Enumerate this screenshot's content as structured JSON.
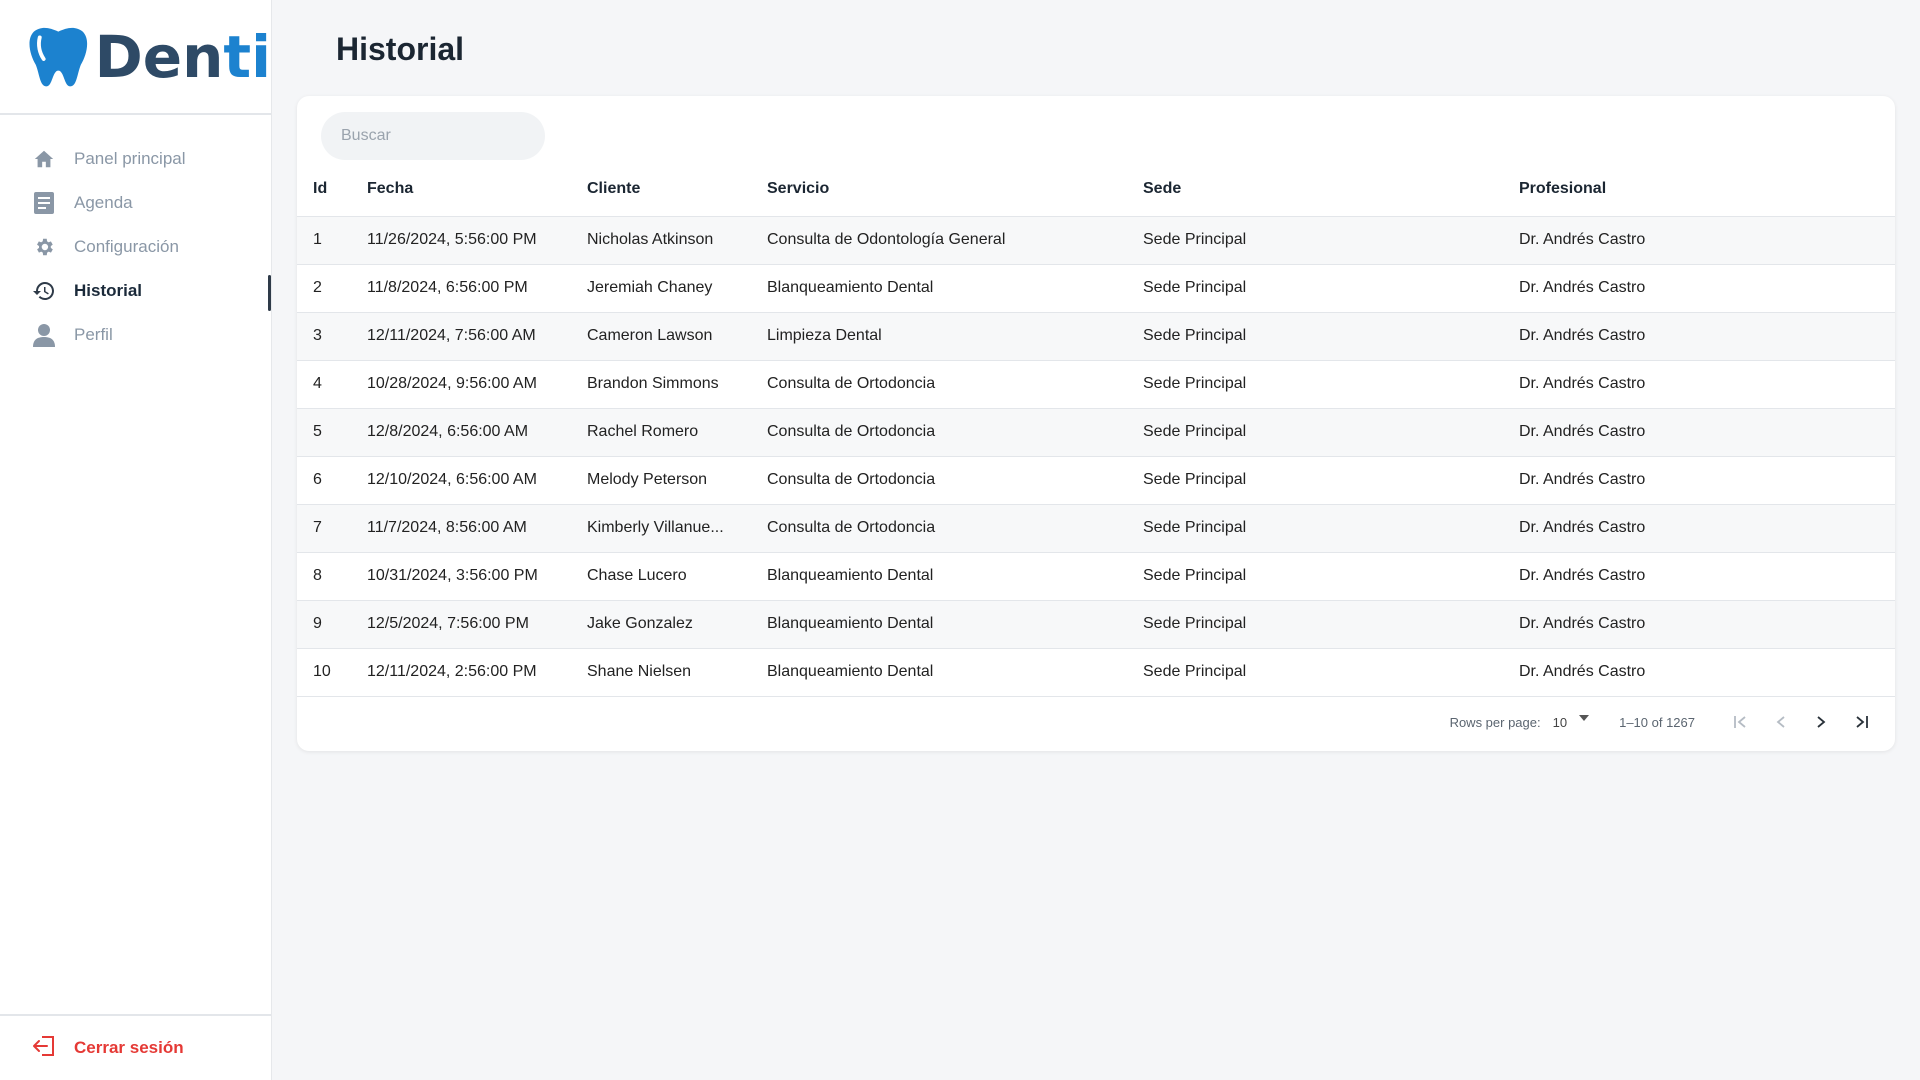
{
  "brand": {
    "part1": "Den",
    "part2": "ti"
  },
  "nav": [
    {
      "label": "Panel principal",
      "icon": "home-icon"
    },
    {
      "label": "Agenda",
      "icon": "book-icon"
    },
    {
      "label": "Configuración",
      "icon": "gear-icon"
    },
    {
      "label": "Historial",
      "icon": "history-icon",
      "active": true
    },
    {
      "label": "Perfil",
      "icon": "user-icon"
    }
  ],
  "logout": {
    "label": "Cerrar sesión",
    "icon": "logout-icon"
  },
  "page": {
    "title": "Historial"
  },
  "search": {
    "placeholder": "Buscar"
  },
  "table": {
    "headers": [
      "Id",
      "Fecha",
      "Cliente",
      "Servicio",
      "Sede",
      "Profesional"
    ],
    "rows": [
      [
        "1",
        "11/26/2024, 5:56:00 PM",
        "Nicholas Atkinson",
        "Consulta de Odontología General",
        "Sede Principal",
        "Dr. Andrés Castro"
      ],
      [
        "2",
        "11/8/2024, 6:56:00 PM",
        "Jeremiah Chaney",
        "Blanqueamiento Dental",
        "Sede Principal",
        "Dr. Andrés Castro"
      ],
      [
        "3",
        "12/11/2024, 7:56:00 AM",
        "Cameron Lawson",
        "Limpieza Dental",
        "Sede Principal",
        "Dr. Andrés Castro"
      ],
      [
        "4",
        "10/28/2024, 9:56:00 AM",
        "Brandon Simmons",
        "Consulta de Ortodoncia",
        "Sede Principal",
        "Dr. Andrés Castro"
      ],
      [
        "5",
        "12/8/2024, 6:56:00 AM",
        "Rachel Romero",
        "Consulta de Ortodoncia",
        "Sede Principal",
        "Dr. Andrés Castro"
      ],
      [
        "6",
        "12/10/2024, 6:56:00 AM",
        "Melody Peterson",
        "Consulta de Ortodoncia",
        "Sede Principal",
        "Dr. Andrés Castro"
      ],
      [
        "7",
        "11/7/2024, 8:56:00 AM",
        "Kimberly Villanue...",
        "Consulta de Ortodoncia",
        "Sede Principal",
        "Dr. Andrés Castro"
      ],
      [
        "8",
        "10/31/2024, 3:56:00 PM",
        "Chase Lucero",
        "Blanqueamiento Dental",
        "Sede Principal",
        "Dr. Andrés Castro"
      ],
      [
        "9",
        "12/5/2024, 7:56:00 PM",
        "Jake Gonzalez",
        "Blanqueamiento Dental",
        "Sede Principal",
        "Dr. Andrés Castro"
      ],
      [
        "10",
        "12/11/2024, 2:56:00 PM",
        "Shane Nielsen",
        "Blanqueamiento Dental",
        "Sede Principal",
        "Dr. Andrés Castro"
      ]
    ]
  },
  "pagination": {
    "rows_label": "Rows per page:",
    "rows_value": "10",
    "range": "1–10 of 1267"
  },
  "colors": {
    "brand_dark": "#2e4a66",
    "brand_blue": "#1c82cf",
    "logout_red": "#e53935",
    "nav_muted": "#8a97a6"
  }
}
